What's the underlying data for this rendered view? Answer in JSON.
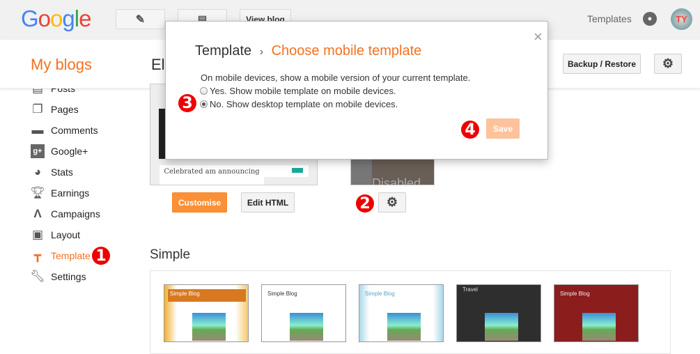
{
  "topbar": {
    "logo": "Google",
    "view_blog": "View blog",
    "templates_link": "Templates",
    "icons": {
      "edit": "pencil-icon",
      "posts": "document-icon",
      "notifications": "bell-icon",
      "avatar": "avatar"
    }
  },
  "header": {
    "my_blogs": "My blogs",
    "blog_title": "Ele",
    "backup_restore": "Backup / Restore"
  },
  "sidebar": {
    "items": [
      {
        "label": "Posts",
        "icon": "posts-icon"
      },
      {
        "label": "Pages",
        "icon": "pages-icon"
      },
      {
        "label": "Comments",
        "icon": "comment-icon"
      },
      {
        "label": "Google+",
        "icon": "google-plus-icon"
      },
      {
        "label": "Stats",
        "icon": "pie-chart-icon"
      },
      {
        "label": "Earnings",
        "icon": "trophy-icon"
      },
      {
        "label": "Campaigns",
        "icon": "adwords-icon"
      },
      {
        "label": "Layout",
        "icon": "layout-icon"
      },
      {
        "label": "Template",
        "icon": "paint-roller-icon",
        "active": true
      },
      {
        "label": "Settings",
        "icon": "wrench-icon"
      }
    ]
  },
  "main": {
    "preview_post_title": "Celebrated am announcing",
    "customise": "Customise",
    "edit_html": "Edit HTML",
    "mobile_status": "Disabled",
    "section_title": "Simple",
    "thumbs": [
      {
        "title": "Simple Blog"
      },
      {
        "title": "Simple Blog"
      },
      {
        "title": "Simple Blog"
      },
      {
        "title": "Travel"
      },
      {
        "title": "Simple Blog"
      }
    ]
  },
  "dialog": {
    "crumb": "Template",
    "separator": "›",
    "title": "Choose mobile template",
    "close": "×",
    "description": "On mobile devices, show a mobile version of your current template.",
    "options": [
      {
        "label": "Yes. Show mobile template on mobile devices.",
        "selected": false
      },
      {
        "label": "No. Show desktop template on mobile devices.",
        "selected": true
      }
    ],
    "save": "Save"
  },
  "annotations": [
    "1",
    "2",
    "3",
    "4"
  ],
  "colors": {
    "accent": "#f4711f",
    "customise_button": "#fb9036",
    "save_disabled": "#ffc29a",
    "badge": "#e00000"
  }
}
